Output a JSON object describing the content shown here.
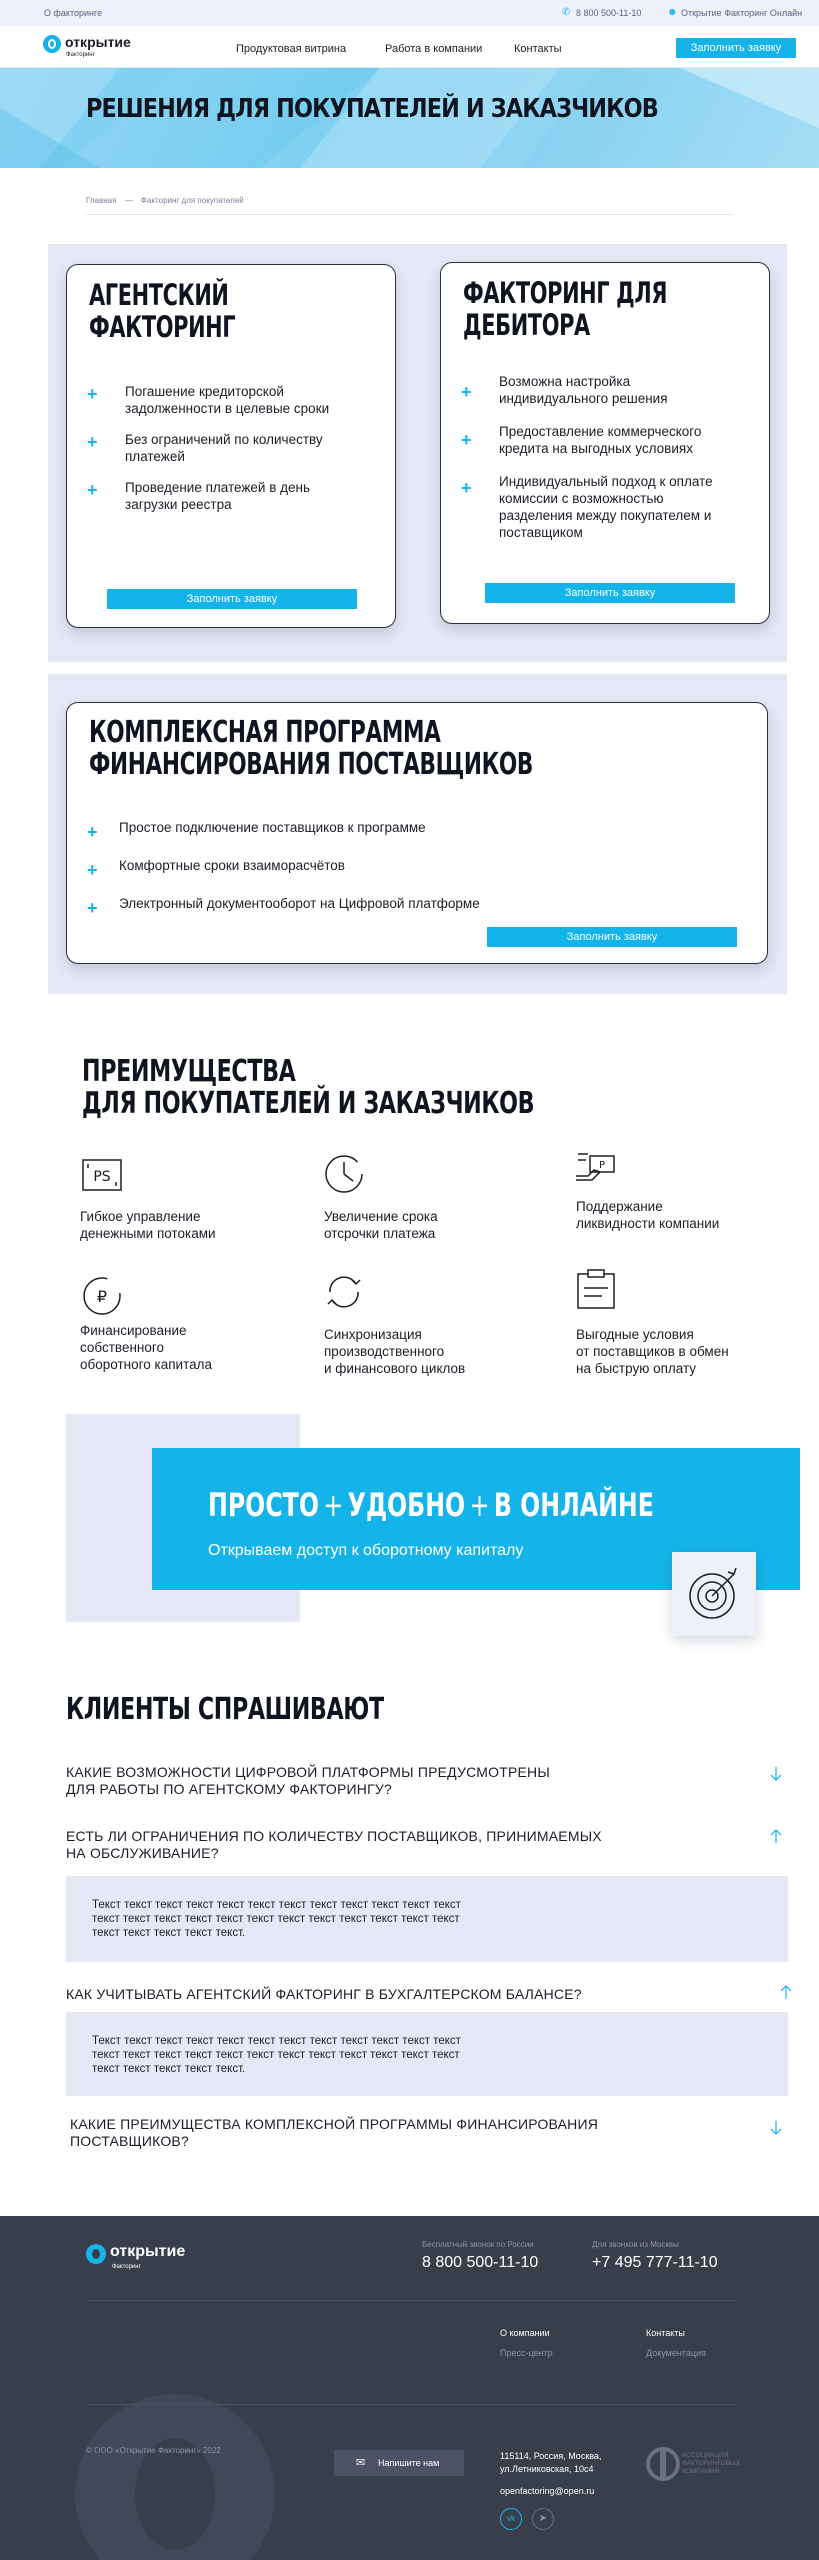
{
  "topbar": {
    "left_link": "О факторинге",
    "phone": "8 800 500-11-10",
    "online": "Открытие Факторинг Онлайн"
  },
  "header": {
    "logo_text": "открытие",
    "logo_sub": "Факторинг",
    "nav": [
      "Продуктовая витрина",
      "Работа в компании",
      "Контакты"
    ],
    "cta": "Заполнить заявку"
  },
  "hero": {
    "title": "РЕШЕНИЯ ДЛЯ ПОКУПАТЕЛЕЙ И ЗАКАЗЧИКОВ"
  },
  "breadcrumb": {
    "home": "Главная",
    "separator": "—",
    "current": "Факторинг для покупателей"
  },
  "products": {
    "agent": {
      "title": [
        "АГЕНТСКИЙ",
        "ФАКТОРИНГ"
      ],
      "items": [
        [
          "Погашение кредиторской",
          "задолженности в целевые сроки"
        ],
        [
          "Без ограничений по количеству",
          "платежей"
        ],
        [
          "Проведение платежей в день",
          "загрузки реестра"
        ]
      ],
      "button": "Заполнить заявку"
    },
    "debtor": {
      "title": [
        "ФАКТОРИНГ ДЛЯ",
        "ДЕБИТОРА"
      ],
      "items": [
        [
          "Возможна настройка",
          "индивидуального решения"
        ],
        [
          "Предоставление коммерческого",
          "кредита на выгодных условиях"
        ],
        [
          "Индивидуальный подход к оплате",
          "комиссии с возможностью",
          "разделения между покупателем и",
          "поставщиком"
        ]
      ],
      "button": "Заполнить заявку"
    },
    "complex": {
      "title": [
        "КОМПЛЕКСНАЯ ПРОГРАММА",
        "ФИНАНСИРОВАНИЯ ПОСТАВЩИКОВ"
      ],
      "items": [
        "Простое подключение поставщиков к программе",
        "Комфортные сроки взаиморасчётов",
        "Электронный документооборот на Цифровой платформе"
      ],
      "button": "Заполнить заявку"
    }
  },
  "advantages": {
    "title": [
      "ПРЕИМУЩЕСТВА",
      "ДЛЯ ПОКУПАТЕЛЕЙ И ЗАКАЗЧИКОВ"
    ],
    "items": [
      {
        "icon": "cash-flow-icon",
        "lines": [
          "Гибкое управление",
          "денежными потоками"
        ]
      },
      {
        "icon": "clock-icon",
        "lines": [
          "Увеличение срока",
          "отсрочки платежа"
        ]
      },
      {
        "icon": "hand-money-icon",
        "lines": [
          "Поддержание",
          "ликвидности компании"
        ]
      },
      {
        "icon": "ruble-coin-icon",
        "lines": [
          "Финансирование",
          "собственного",
          "оборотного капитала"
        ]
      },
      {
        "icon": "sync-icon",
        "lines": [
          "Синхронизация",
          "производственного",
          "и финансового циклов"
        ]
      },
      {
        "icon": "clipboard-icon",
        "lines": [
          "Выгодные условия",
          "от поставщиков  в обмен",
          "на быструю оплату"
        ]
      }
    ]
  },
  "promo": {
    "title_parts": [
      "ПРОСТО",
      "УДОБНО",
      "В ОНЛАЙНЕ"
    ],
    "subtitle": "Открываем доступ к оборотному капиталу",
    "icon": "target-icon"
  },
  "faq": {
    "title": "КЛИЕНТЫ СПРАШИВАЮТ",
    "items": [
      {
        "q": [
          "КАКИЕ ВОЗМОЖНОСТИ ЦИФРОВОЙ ПЛАТФОРМЫ ПРЕДУСМОТРЕНЫ",
          "ДЛЯ РАБОТЫ ПО АГЕНТСКОМУ ФАКТОРИНГУ?"
        ],
        "open": false
      },
      {
        "q": [
          "ЕСТЬ ЛИ ОГРАНИЧЕНИЯ ПО КОЛИЧЕСТВУ ПОСТАВЩИКОВ, ПРИНИМАЕМЫХ",
          "НА ОБСЛУЖИВАНИЕ?"
        ],
        "open": true,
        "a": [
          "Текст текст текст текст текст текст текст текст текст текст текст текст",
          " текст текст текст текст текст текст текст текст текст текст текст текст",
          " текст текст текст текст текст."
        ]
      },
      {
        "q": [
          "КАК УЧИТЫВАТЬ АГЕНТСКИЙ ФАКТОРИНГ В БУХГАЛТЕРСКОМ БАЛАНСЕ?"
        ],
        "open": true,
        "a": [
          "Текст текст текст текст текст текст текст текст текст текст текст текст",
          " текст текст текст текст текст текст текст текст текст текст текст текст",
          " текст текст текст текст текст."
        ]
      },
      {
        "q": [
          "КАКИЕ ПРЕИМУЩЕСТВА КОМПЛЕКСНОЙ ПРОГРАММЫ ФИНАНСИРОВАНИЯ",
          "ПОСТАВЩИКОВ?"
        ],
        "open": false
      }
    ]
  },
  "footer": {
    "logo_text": "открытие",
    "logo_sub": "Факторинг",
    "phone1_label": "Бесплатный звонок по России",
    "phone1": "8 800 500-11-10",
    "phone2_label": "Для звонков из Москвы",
    "phone2": "+7 495 777-11-10",
    "links": [
      "О компании",
      "Пресс-центр",
      "Контакты",
      "Документация"
    ],
    "copyright": "© ООО «Открытие Факторинг» 2022",
    "write_button": "Напишите нам",
    "address": [
      "115114, Россия, Москва,",
      "ул.Летниковская, 10с4"
    ],
    "email": "openfactoring@open.ru",
    "association": [
      "АССОЦИАЦИЯ",
      "ФАКТОРИНГОВЫХ",
      "КОМПАНИЙ"
    ],
    "social": [
      "vk-icon",
      "telegram-icon"
    ]
  },
  "colors": {
    "accent": "#14b4ea",
    "panel": "#e6e8f6",
    "footer": "#393e4b",
    "text": "#1b1e27"
  }
}
